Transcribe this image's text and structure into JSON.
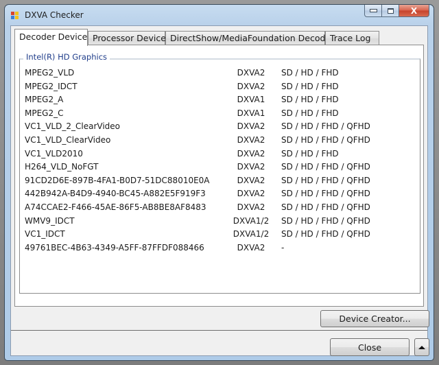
{
  "window": {
    "title": "DXVA Checker",
    "controls": {
      "minimize": "minimize",
      "maximize": "maximize",
      "close": "X"
    }
  },
  "tabs": [
    {
      "label": "Decoder Device",
      "active": true
    },
    {
      "label": "Processor Device",
      "active": false
    },
    {
      "label": "DirectShow/MediaFoundation Decoder",
      "active": false
    },
    {
      "label": "Trace Log",
      "active": false
    }
  ],
  "group": {
    "title": "Intel(R) HD Graphics",
    "title_color": "#1f3d8a"
  },
  "decoders": [
    {
      "name": "MPEG2_VLD",
      "api": "DXVA2",
      "resolutions": "SD / HD / FHD"
    },
    {
      "name": "MPEG2_IDCT",
      "api": "DXVA2",
      "resolutions": "SD / HD / FHD"
    },
    {
      "name": "MPEG2_A",
      "api": "DXVA1",
      "resolutions": "SD / HD / FHD"
    },
    {
      "name": "MPEG2_C",
      "api": "DXVA1",
      "resolutions": "SD / HD / FHD"
    },
    {
      "name": "VC1_VLD_2_ClearVideo",
      "api": "DXVA2",
      "resolutions": "SD / HD / FHD / QFHD"
    },
    {
      "name": "VC1_VLD_ClearVideo",
      "api": "DXVA2",
      "resolutions": "SD / HD / FHD / QFHD"
    },
    {
      "name": "VC1_VLD2010",
      "api": "DXVA2",
      "resolutions": "SD / HD / FHD"
    },
    {
      "name": "H264_VLD_NoFGT",
      "api": "DXVA2",
      "resolutions": "SD / HD / FHD / QFHD"
    },
    {
      "name": "91CD2D6E-897B-4FA1-B0D7-51DC88010E0A",
      "api": "DXVA2",
      "resolutions": "SD / HD / FHD / QFHD"
    },
    {
      "name": "442B942A-B4D9-4940-BC45-A882E5F919F3",
      "api": "DXVA2",
      "resolutions": "SD / HD / FHD / QFHD"
    },
    {
      "name": "A74CCAE2-F466-45AE-86F5-AB8BE8AF8483",
      "api": "DXVA2",
      "resolutions": "SD / HD / FHD / QFHD"
    },
    {
      "name": "WMV9_IDCT",
      "api": "DXVA1/2",
      "resolutions": "SD / HD / FHD / QFHD"
    },
    {
      "name": "VC1_IDCT",
      "api": "DXVA1/2",
      "resolutions": "SD / HD / FHD / QFHD"
    },
    {
      "name": "49761BEC-4B63-4349-A5FF-87FFDF088466",
      "api": "DXVA2",
      "resolutions": "-"
    }
  ],
  "buttons": {
    "device_creator": "Device Creator...",
    "close": "Close",
    "expand": "expand-up"
  },
  "colors": {
    "title_bar": "#b9d1ea",
    "close_button": "#c6422b",
    "dialog_bg": "#f0f0f0"
  }
}
